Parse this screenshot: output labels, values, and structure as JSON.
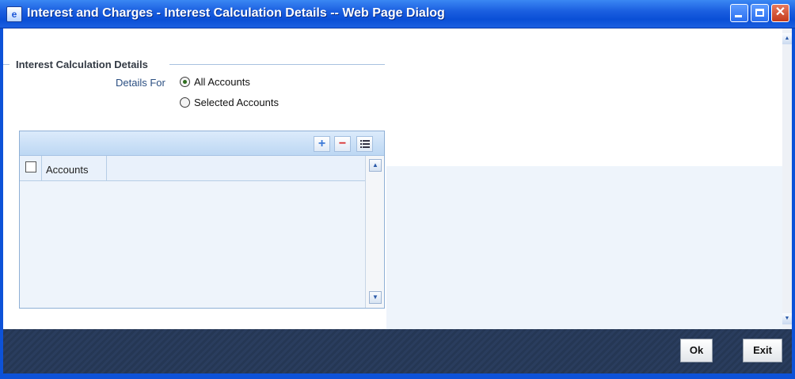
{
  "window": {
    "title": "Interest and Charges - Interest Calculation Details -- Web Page Dialog",
    "icon": "ie-page-icon",
    "controls": {
      "minimize": "minimize-icon",
      "maximize": "maximize-icon",
      "close": "✕"
    }
  },
  "section": {
    "legend": "Interest Calculation Details"
  },
  "details_for": {
    "label": "Details For",
    "options": [
      {
        "label": "All Accounts",
        "selected": true
      },
      {
        "label": "Selected Accounts",
        "selected": false
      }
    ]
  },
  "grid": {
    "toolbar": {
      "add": "+",
      "delete": "−",
      "single_view": "single-record-view-icon"
    },
    "columns": [
      "Accounts"
    ],
    "rows": []
  },
  "footer": {
    "ok_label": "Ok",
    "exit_label": "Exit"
  }
}
